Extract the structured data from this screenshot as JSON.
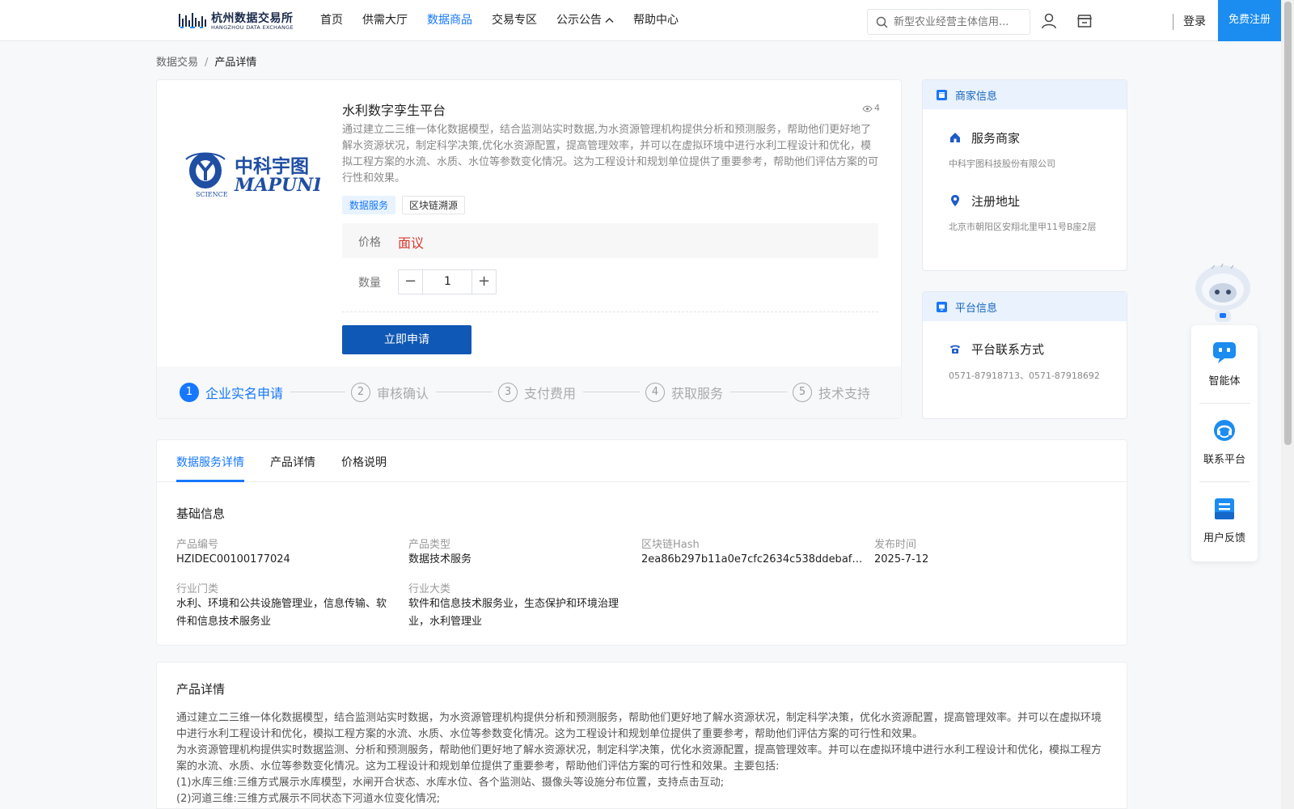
{
  "header": {
    "logo_cn": "杭州数据交易所",
    "logo_en": "HANGZHOU DATA EXCHANGE",
    "nav": [
      {
        "label": "首页",
        "active": false
      },
      {
        "label": "供需大厅",
        "active": false
      },
      {
        "label": "数据商品",
        "active": true
      },
      {
        "label": "交易专区",
        "active": false
      },
      {
        "label": "公示公告",
        "active": false
      },
      {
        "label": "帮助中心",
        "active": false
      }
    ],
    "search_placeholder": "新型农业经营主体信用...",
    "login": "登录",
    "register": "免费注册",
    "accent_color": "#1677ff"
  },
  "breadcrumb": {
    "root": "数据交易",
    "separator": "/",
    "current": "产品详情"
  },
  "product": {
    "logo_cn": "中科宇图",
    "logo_en": "MAPUNI",
    "logo_small": "SCIENCE",
    "title": "水利数字孪生平台",
    "views": "4",
    "description": "通过建立二三维一体化数据模型，结合监测站实时数据,为水资源管理机构提供分析和预测服务，帮助他们更好地了解水资源状况，制定科学决策,优化水资源配置，提高管理效率，并可以在虚拟环境中进行水利工程设计和优化，模拟工程方案的水流、水质、水位等参数变化情况。这为工程设计和规划单位提供了重要参考，帮助他们评估方案的可行性和效果。",
    "tags": [
      "数据服务",
      "区块链溯源"
    ],
    "price_label": "价格",
    "price_value": "面议",
    "quantity_label": "数量",
    "quantity": "1",
    "apply_button": "立即申请",
    "price_color": "#d9362b"
  },
  "steps": [
    {
      "num": "1",
      "label": "企业实名申请",
      "active": true
    },
    {
      "num": "2",
      "label": "审核确认",
      "active": false
    },
    {
      "num": "3",
      "label": "支付费用",
      "active": false
    },
    {
      "num": "4",
      "label": "获取服务",
      "active": false
    },
    {
      "num": "5",
      "label": "技术支持",
      "active": false
    }
  ],
  "merchant": {
    "heading": "商家信息",
    "merchant_label": "服务商家",
    "merchant_value": "中科宇图科技股份有限公司",
    "address_label": "注册地址",
    "address_value": "北京市朝阳区安翔北里甲11号B座2层"
  },
  "platform": {
    "heading": "平台信息",
    "contact_label": "平台联系方式",
    "contact_value": "0571-87918713、0571-87918692"
  },
  "tabs": [
    {
      "label": "数据服务详情",
      "active": true
    },
    {
      "label": "产品详情",
      "active": false
    },
    {
      "label": "价格说明",
      "active": false
    }
  ],
  "basic_info": {
    "title": "基础信息",
    "fields": [
      {
        "label": "产品编号",
        "value": "HZIDEC00100177024"
      },
      {
        "label": "产品类型",
        "value": "数据技术服务"
      },
      {
        "label": "区块链Hash",
        "value": "2ea86b297b11a0e7cfc2634c538ddebaf97..."
      },
      {
        "label": "发布时间",
        "value": "2025-7-12"
      },
      {
        "label": "行业门类",
        "value": "水利、环境和公共设施管理业，信息传输、软件和信息技术服务业"
      },
      {
        "label": "行业大类",
        "value": "软件和信息技术服务业，生态保护和环境治理业，水利管理业"
      }
    ]
  },
  "product_detail": {
    "title": "产品详情",
    "lines": [
      "通过建立二三维一体化数据模型，结合监测站实时数据，为水资源管理机构提供分析和预测服务，帮助他们更好地了解水资源状况，制定科学决策，优化水资源配置，提高管理效率。并可以在虚拟环境中进行水利工程设计和优化，模拟工程方案的水流、水质、水位等参数变化情况。这为工程设计和规划单位提供了重要参考，帮助他们评估方案的可行性和效果。",
      "为水资源管理机构提供实时数据监测、分析和预测服务，帮助他们更好地了解水资源状况，制定科学决策，优化水资源配置，提高管理效率。并可以在虚拟环境中进行水利工程设计和优化，模拟工程方案的水流、水质、水位等参数变化情况。这为工程设计和规划单位提供了重要参考，帮助他们评估方案的可行性和效果。主要包括:",
      "(1)水库三维:三维方式展示水库模型，水闸开合状态、水库水位、各个监测站、摄像头等设施分布位置，支持点击互动;",
      "(2)河道三维:三维方式展示不同状态下河道水位变化情况;"
    ]
  },
  "float_panel": {
    "items": [
      {
        "label": "智能体"
      },
      {
        "label": "联系平台"
      },
      {
        "label": "用户反馈"
      }
    ]
  }
}
